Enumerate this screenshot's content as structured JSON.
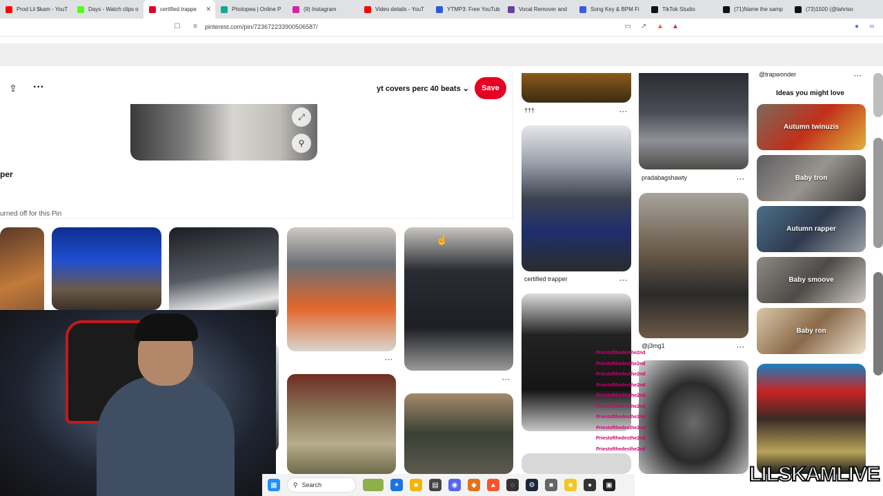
{
  "tabs": [
    {
      "title": "Prod Lil $kam - YouT",
      "color": "#ff0000"
    },
    {
      "title": "Days - Watch clips o",
      "color": "#53fc18"
    },
    {
      "title": "certified trappe",
      "color": "#e60023",
      "active": true
    },
    {
      "title": "Photopea | Online P",
      "color": "#18a497"
    },
    {
      "title": "(9) Instagram",
      "color": "#d6249f"
    },
    {
      "title": "Video details - YouT",
      "color": "#ff0000"
    },
    {
      "title": "YTMP3: Free YouTub",
      "color": "#2a5bd7"
    },
    {
      "title": "Vocal Remover and",
      "color": "#6b3fa0"
    },
    {
      "title": "Song Key & BPM Fi",
      "color": "#3b5bdb"
    },
    {
      "title": "TikTok Studio",
      "color": "#111111"
    },
    {
      "title": "(71)Name the samp",
      "color": "#111111"
    },
    {
      "title": "(73)1500 (@lahriso",
      "color": "#111111"
    }
  ],
  "address": {
    "url": "pinterest.com/pin/723672233900506587/"
  },
  "pin": {
    "board": "yt covers perc 40 beats",
    "save": "Save",
    "title": "per",
    "comments_note": "urned off for this Pin"
  },
  "feed": {
    "caption_top": "†††",
    "pradabagshawty": "pradabagshawty",
    "certified_trapper": "certified trapper",
    "j3mg1": "@j3mg1",
    "trapwonder": "@trapwonder"
  },
  "ideas": {
    "title": "Ideas you might love",
    "items": [
      "Autumn twinuzis",
      "Baby tron",
      "Autumn rapper",
      "Baby smoove",
      "Baby ron"
    ]
  },
  "chat_overlay": {
    "lines": [
      "Priestofthedesthe2nd",
      "Priestofthedesthe2nd",
      "Priestofthedesthe2nd",
      "Priestofthedesthe2nd",
      "Priestofthedesthe2nd",
      "Priestofthedesthe2nd",
      "Priestofthedesthe2nd",
      "Priestofthedesthe2nd",
      "Priestofthedesthe2nd",
      "Priestofthedesthe2nd"
    ]
  },
  "taskbar": {
    "search": "Search"
  },
  "watermark": "LILSKAMLIVE",
  "colors": {
    "save": "#e60023",
    "taskbar": "#f3f3f3"
  }
}
